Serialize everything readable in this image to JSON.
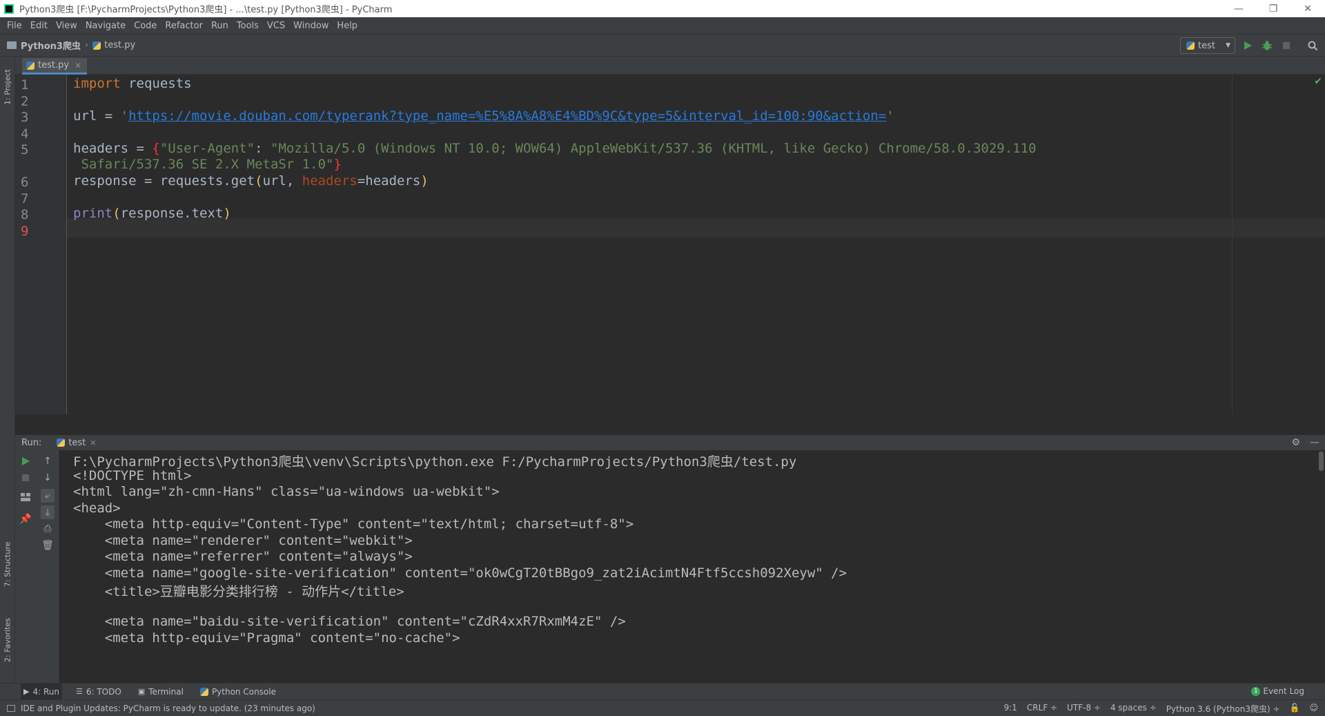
{
  "window": {
    "title": "Python3爬虫 [F:\\PycharmProjects\\Python3爬虫] - ...\\test.py [Python3爬虫] - PyCharm",
    "controls": [
      "—",
      "❐",
      "✕"
    ]
  },
  "menu": [
    "File",
    "Edit",
    "View",
    "Navigate",
    "Code",
    "Refactor",
    "Run",
    "Tools",
    "VCS",
    "Window",
    "Help"
  ],
  "navbar": {
    "project": "Python3爬虫",
    "file": "test.py",
    "run_config": "test"
  },
  "left_stripe": {
    "project": "1: Project",
    "structure": "7: Structure",
    "favorites": "2: Favorites"
  },
  "editor": {
    "tab": "test.py",
    "line_numbers": [
      "1",
      "2",
      "3",
      "4",
      "5",
      "6",
      "7",
      "8",
      "9"
    ],
    "code": {
      "l1_kw": "import",
      "l1_rest": " requests",
      "l3_var": "url = ",
      "l3_q1": "'",
      "l3_url": "https://movie.douban.com/typerank?type_name=%E5%8A%A8%E4%BD%9C&type=5&interval_id=100:90&action=",
      "l3_q2": "'",
      "l5_var": "headers = ",
      "l5_open": "{",
      "l5_str1": "\"User-Agent\"",
      "l5_colon": ": ",
      "l5_str2": "\"Mozilla/5.0 (Windows NT 10.0; WOW64) AppleWebKit/537.36 (KHTML, like Gecko) Chrome/58.0.3029.110",
      "l5b_str": " Safari/537.36 SE 2.X MetaSr 1.0\"",
      "l5b_close": "}",
      "l6_a": "response = requests.get",
      "l6_open": "(",
      "l6_b": "url, ",
      "l6_param": "headers",
      "l6_c": "=headers",
      "l6_close": ")",
      "l8_fn": "print",
      "l8_open": "(",
      "l8_mid": "response.text",
      "l8_close": ")"
    }
  },
  "run": {
    "label": "Run:",
    "tab": "test",
    "output": [
      "F:\\PycharmProjects\\Python3爬虫\\venv\\Scripts\\python.exe F:/PycharmProjects/Python3爬虫/test.py",
      "<!DOCTYPE html>",
      "<html lang=\"zh-cmn-Hans\" class=\"ua-windows ua-webkit\">",
      "<head>",
      "    <meta http-equiv=\"Content-Type\" content=\"text/html; charset=utf-8\">",
      "    <meta name=\"renderer\" content=\"webkit\">",
      "    <meta name=\"referrer\" content=\"always\">",
      "    <meta name=\"google-site-verification\" content=\"ok0wCgT20tBBgo9_zat2iAcimtN4Ftf5ccsh092Xeyw\" />",
      "    <title>豆瓣电影分类排行榜 - 动作片</title>",
      "",
      "    <meta name=\"baidu-site-verification\" content=\"cZdR4xxR7RxmM4zE\" />",
      "    <meta http-equiv=\"Pragma\" content=\"no-cache\">"
    ]
  },
  "bottom_tabs": {
    "run": "4: Run",
    "todo": "6: TODO",
    "terminal": "Terminal",
    "console": "Python Console",
    "event_badge": "1",
    "event_log": "Event Log"
  },
  "status": {
    "message": "IDE and Plugin Updates: PyCharm is ready to update. (23 minutes ago)",
    "position": "9:1",
    "line_sep": "CRLF ÷",
    "encoding": "UTF-8 ÷",
    "indent": "4 spaces ÷",
    "interpreter": "Python 3.6 (Python3爬虫) ÷"
  },
  "colors": {
    "background": "#2b2b2b",
    "panel": "#3c3f41",
    "keyword": "#cc7832",
    "string": "#6a8759",
    "link": "#287bde"
  }
}
